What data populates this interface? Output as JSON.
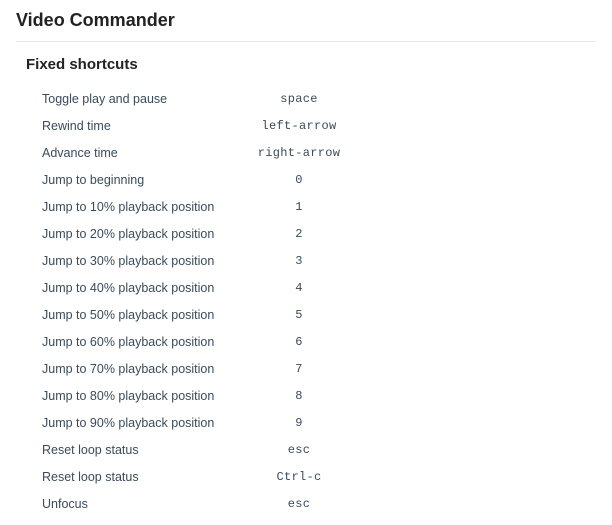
{
  "app": {
    "title": "Video Commander"
  },
  "section": {
    "title": "Fixed shortcuts"
  },
  "shortcuts": [
    {
      "label": "Toggle play and pause",
      "key": "space"
    },
    {
      "label": "Rewind time",
      "key": "left-arrow"
    },
    {
      "label": "Advance time",
      "key": "right-arrow"
    },
    {
      "label": "Jump to beginning",
      "key": "0"
    },
    {
      "label": "Jump to 10% playback position",
      "key": "1"
    },
    {
      "label": "Jump to 20% playback position",
      "key": "2"
    },
    {
      "label": "Jump to 30% playback position",
      "key": "3"
    },
    {
      "label": "Jump to 40% playback position",
      "key": "4"
    },
    {
      "label": "Jump to 50% playback position",
      "key": "5"
    },
    {
      "label": "Jump to 60% playback position",
      "key": "6"
    },
    {
      "label": "Jump to 70% playback position",
      "key": "7"
    },
    {
      "label": "Jump to 80% playback position",
      "key": "8"
    },
    {
      "label": "Jump to 90% playback position",
      "key": "9"
    },
    {
      "label": "Reset loop status",
      "key": "esc"
    },
    {
      "label": "Reset loop status",
      "key": "Ctrl-c"
    },
    {
      "label": "Unfocus",
      "key": "esc"
    }
  ]
}
